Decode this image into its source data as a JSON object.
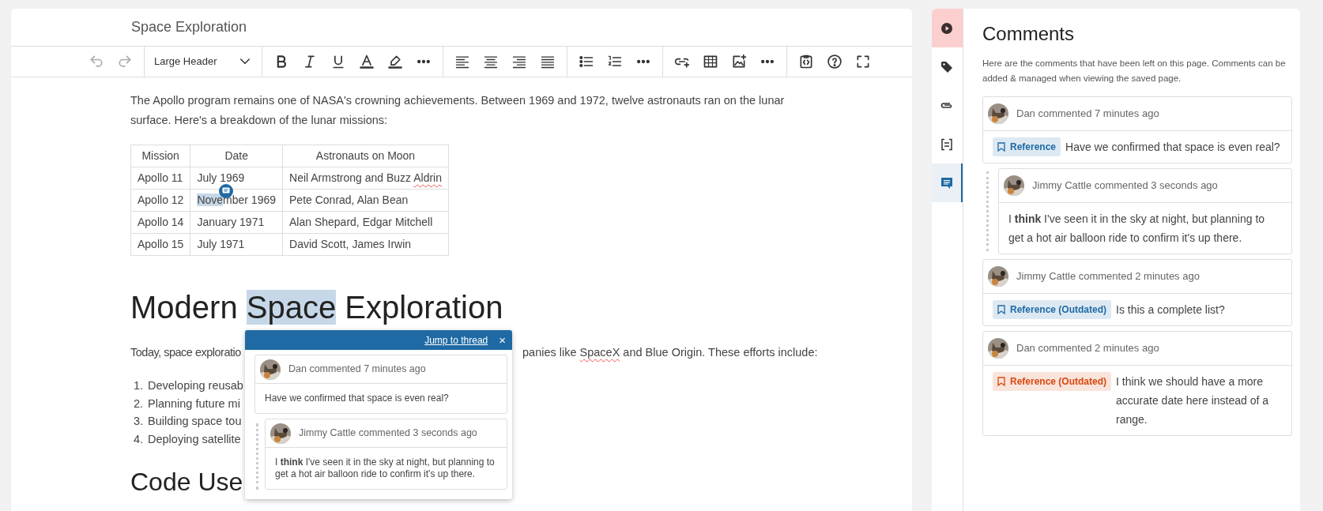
{
  "editor": {
    "title": "Space Exploration",
    "toolbar": {
      "history": [
        {
          "disabled": true
        },
        {
          "disabled": true
        }
      ],
      "format": "Large Header"
    },
    "intro": "The Apollo program remains one of NASA's crowning achievements. Between 1969 and 1972, twelve astronauts ran on the lunar surface. Here's a breakdown of the lunar missions:",
    "table": {
      "columns": [
        "Mission",
        "Date",
        "Astronauts on Moon"
      ],
      "rows": [
        [
          "Apollo 11",
          "July 1969",
          {
            "parts": [
              {
                "text": "Neil Armstrong and Buzz "
              },
              {
                "text": "Aldrin",
                "misspelled": true
              }
            ]
          }
        ],
        [
          "Apollo 12",
          {
            "parts": [
              {
                "text": "Nove",
                "highlighted": true
              },
              {
                "text": "mber 1969"
              }
            ],
            "comment_marker": true
          },
          "Pete Conrad, Alan Bean"
        ],
        [
          "Apollo 14",
          "January 1971",
          "Alan Shepard, Edgar Mitchell"
        ],
        [
          "Apollo 15",
          "July 1971",
          "David Scott, James Irwin"
        ]
      ]
    },
    "heading": [
      {
        "text": "Modern "
      },
      {
        "text": "Space",
        "highlighted": true
      },
      {
        "text": " Exploration"
      }
    ],
    "paragraph_visible_start": "Today, space exploratio",
    "paragraph_visible_end": [
      {
        "text": "panies like "
      },
      {
        "text": "SpaceX",
        "misspelled": true
      },
      {
        "text": " and Blue Origin. These efforts include:"
      }
    ],
    "list_items_visible": [
      {
        "marker": "1.",
        "text": "Developing reusab"
      },
      {
        "marker": "2.",
        "text": "Planning future mi"
      },
      {
        "marker": "3.",
        "text": "Building space tou"
      },
      {
        "marker": "4.",
        "text": "Deploying satellite"
      }
    ],
    "heading_2_visible": "Code Use",
    "popup": {
      "link": "Jump to thread",
      "close": "×",
      "comment": {
        "author_line": "Dan commented 7 minutes ago",
        "body": "Have we confirmed that space is even real?",
        "replies": [
          {
            "author_line": "Jimmy Cattle commented 3 seconds ago",
            "body": "I **think** I've seen it in the sky at night, but planning to get a hot air balloon ride to confirm it's up there."
          }
        ]
      }
    }
  },
  "sidebar": {
    "rail": [
      {
        "kind": "play",
        "selected": false
      },
      {
        "kind": "tag",
        "selected": false
      },
      {
        "kind": "attachment",
        "selected": false
      },
      {
        "kind": "template",
        "selected": false
      },
      {
        "kind": "comments",
        "selected": true
      }
    ],
    "title": "Comments",
    "description": "Here are the comments that have been left on this page. Comments can be added & managed when viewing the saved page.",
    "comments": [
      {
        "author_line": "Dan commented 7 minutes ago",
        "chip": {
          "text": "Reference",
          "color": "#1f6aa5"
        },
        "body": "Have we confirmed that space is even real?",
        "replies": [
          {
            "author_line": "Jimmy Cattle commented 3 seconds ago",
            "body": "I **think** I've seen it in the sky at night, but planning to get a hot air balloon ride to confirm it's up there."
          }
        ]
      },
      {
        "author_line": "Jimmy Cattle commented 2 minutes ago",
        "chip": {
          "text": "Reference (Outdated)",
          "color": "#1f6aa5"
        },
        "body": "Is this a complete list?"
      },
      {
        "author_line": "Dan commented 2 minutes ago",
        "chip": {
          "text": "Reference (Outdated)",
          "color": "#d9480f"
        },
        "body": "I think we should have a more accurate date here instead of a range."
      }
    ]
  }
}
